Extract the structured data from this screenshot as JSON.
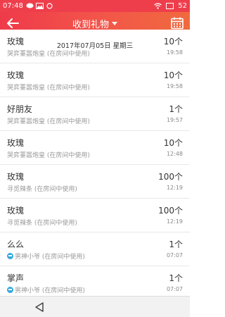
{
  "status": {
    "time": "07:48",
    "battery": "52"
  },
  "header": {
    "title": "收到礼物"
  },
  "date_overlay": "2017年07月05日 星期三",
  "items": [
    {
      "name": "玫瑰",
      "sub": "哭弈薹嚣炮皇 (在房间中使用)",
      "count": "10个",
      "time": "19:58",
      "badge": false
    },
    {
      "name": "玫瑰",
      "sub": "哭弈薹嚣炮皇 (在房间中使用)",
      "count": "10个",
      "time": "19:58",
      "badge": false
    },
    {
      "name": "好朋友",
      "sub": "哭弈薹嚣炮皇 (在房间中使用)",
      "count": "1个",
      "time": "19:57",
      "badge": false
    },
    {
      "name": "玫瑰",
      "sub": "哭弈薹嚣炮皇 (在房间中使用)",
      "count": "10个",
      "time": "12:48",
      "badge": false
    },
    {
      "name": "玫瑰",
      "sub": "寻觅辣条 (在房间中使用)",
      "count": "100个",
      "time": "12:19",
      "badge": false
    },
    {
      "name": "玫瑰",
      "sub": "寻觅辣条 (在房间中使用)",
      "count": "100个",
      "time": "12:19",
      "badge": false
    },
    {
      "name": "么么",
      "sub": "男神小爷 (在房间中使用)",
      "count": "1个",
      "time": "07:07",
      "badge": true
    },
    {
      "name": "掌声",
      "sub": "男神小爷 (在房间中使用)",
      "count": "1个",
      "time": "07:07",
      "badge": true
    }
  ]
}
